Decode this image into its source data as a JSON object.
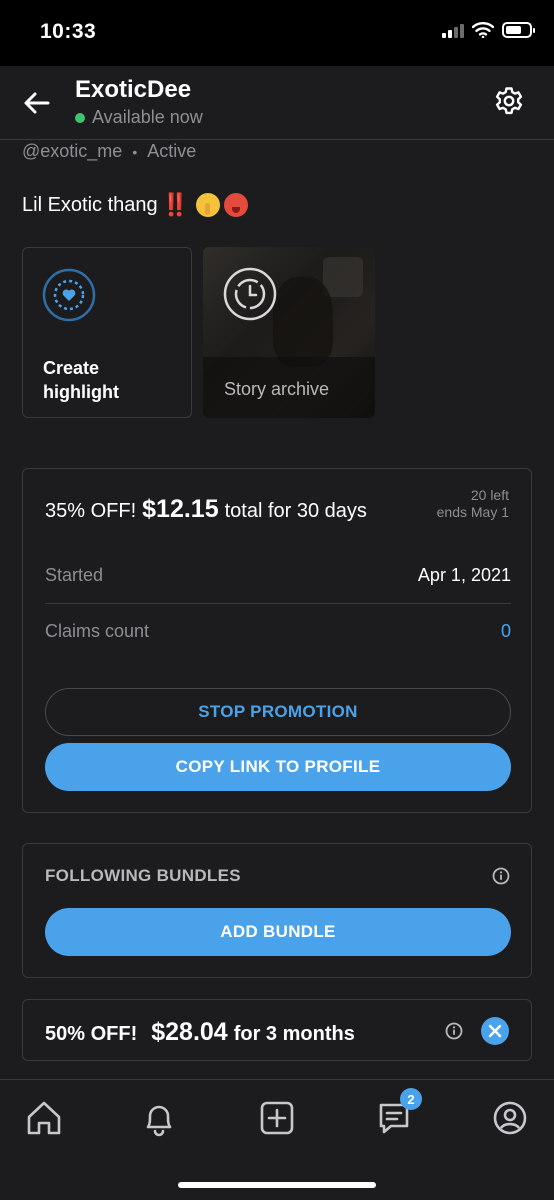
{
  "status_bar": {
    "time": "10:33"
  },
  "header": {
    "name": "ExoticDee",
    "status": "Available now"
  },
  "profile": {
    "handle": "@exotic_me",
    "separator": "•",
    "activity": "Active",
    "bio": "Lil Exotic thang",
    "bio_emphasis": "‼️"
  },
  "highlights": {
    "create_label": "Create highlight",
    "archive_label": "Story archive"
  },
  "promotion": {
    "discount": "35% OFF!",
    "price": "$12.15",
    "terms": "total for 30 days",
    "remaining": "20 left",
    "ends": "ends May 1",
    "started_label": "Started",
    "started_value": "Apr 1, 2021",
    "claims_label": "Claims count",
    "claims_value": "0",
    "stop_label": "STOP PROMOTION",
    "copy_label": "COPY LINK TO PROFILE"
  },
  "bundles": {
    "title": "FOLLOWING BUNDLES",
    "add_label": "ADD BUNDLE"
  },
  "bundle_offer": {
    "discount": "50% OFF!",
    "price": "$28.04",
    "terms": "for 3 months"
  },
  "tabbar": {
    "messages_badge": "2",
    "items": [
      "home-icon",
      "bell-icon",
      "plus-square-icon",
      "messages-icon",
      "profile-icon"
    ]
  },
  "colors": {
    "accent": "#4aa3ea",
    "online": "#3ec46d",
    "background": "#1c1c1e"
  }
}
